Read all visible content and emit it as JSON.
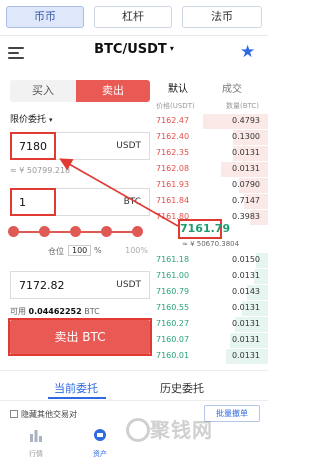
{
  "market_tabs": [
    "币币",
    "杠杆",
    "法币"
  ],
  "header": {
    "pair": "BTC/USDT",
    "pair_caret": "▾",
    "menu_icon": "menu-icon",
    "favorite_icon": "star-icon"
  },
  "trade_tabs": {
    "buy": "买入",
    "sell": "卖出"
  },
  "order_type": {
    "label": "限价委托",
    "caret": "▾"
  },
  "price_field": {
    "value": "7180",
    "unit": "USDT",
    "approx": "≈ ¥ 50799.218"
  },
  "amount_field": {
    "value": "1",
    "unit": "BTC"
  },
  "position": {
    "label": "仓位",
    "percent": "100",
    "unit": "%",
    "right_label": "100%",
    "slider_fraction": 1.0
  },
  "total_field": {
    "value": "7172.82",
    "unit": "USDT"
  },
  "available": {
    "label": "可用",
    "amount": "0.04462252",
    "unit": "BTC"
  },
  "sell_button": "卖出 BTC",
  "orderbook": {
    "tabs": [
      "默认",
      "成交"
    ],
    "headers": {
      "price": "价格(USDT)",
      "qty": "数量(BTC)"
    },
    "asks": [
      {
        "price": "7162.47",
        "qty": "0.4793",
        "depth": 0.55
      },
      {
        "price": "7162.40",
        "qty": "0.1300",
        "depth": 0.3
      },
      {
        "price": "7162.35",
        "qty": "0.0131",
        "depth": 0.3
      },
      {
        "price": "7162.08",
        "qty": "0.0131",
        "depth": 0.4
      },
      {
        "price": "7161.93",
        "qty": "0.0790",
        "depth": 0.25
      },
      {
        "price": "7161.84",
        "qty": "0.7147",
        "depth": 0.2
      },
      {
        "price": "7161.80",
        "qty": "0.3983",
        "depth": 0.15
      }
    ],
    "last_price": "7161.79",
    "last_approx": "≈ ¥ 50670.3804",
    "bids": [
      {
        "price": "7161.18",
        "qty": "0.0150",
        "depth": 0.1
      },
      {
        "price": "7161.00",
        "qty": "0.0131",
        "depth": 0.12
      },
      {
        "price": "7160.79",
        "qty": "0.0143",
        "depth": 0.18
      },
      {
        "price": "7160.55",
        "qty": "0.0131",
        "depth": 0.22
      },
      {
        "price": "7160.27",
        "qty": "0.0131",
        "depth": 0.28
      },
      {
        "price": "7160.07",
        "qty": "0.0131",
        "depth": 0.32
      },
      {
        "price": "7160.01",
        "qty": "0.0131",
        "depth": 0.36
      }
    ]
  },
  "orders": {
    "current": "当前委托",
    "history": "历史委托",
    "hide_others": "隐藏其他交易对",
    "batch_cancel": "批量撤单"
  },
  "bottom_nav": [
    {
      "label": "行情",
      "icon": "bar-chart-icon"
    },
    {
      "label": "资产",
      "icon": "wallet-icon"
    }
  ],
  "watermark": "聚钱网",
  "colors": {
    "sell": "#ea5a55",
    "buy": "#27a37a",
    "accent": "#2f6be0",
    "highlight_box": "#e03a32"
  }
}
